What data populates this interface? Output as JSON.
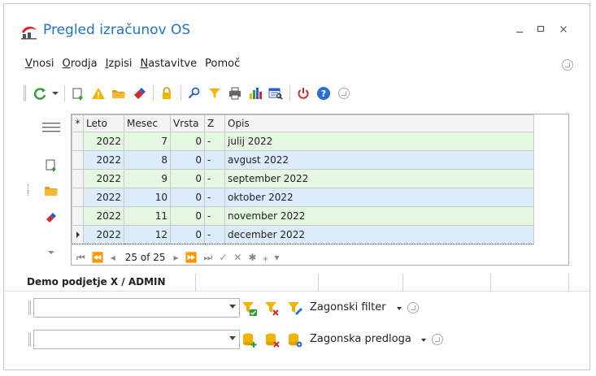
{
  "window": {
    "title": "Pregled izračunov OS"
  },
  "menu": {
    "items": [
      {
        "first": "V",
        "rest": "nosi"
      },
      {
        "first": "O",
        "rest": "rodja"
      },
      {
        "first": "I",
        "rest": "zpisi"
      },
      {
        "first": "N",
        "rest": "astavitve"
      },
      {
        "first": "",
        "rest": "Pomoč"
      }
    ]
  },
  "grid": {
    "columns": [
      "Leto",
      "Mesec",
      "Vrsta",
      "Z",
      "Opis"
    ],
    "rows": [
      {
        "leto": "2022",
        "mesec": "7",
        "vrsta": "0",
        "z": "-",
        "opis": "julij 2022"
      },
      {
        "leto": "2022",
        "mesec": "8",
        "vrsta": "0",
        "z": "-",
        "opis": "avgust 2022"
      },
      {
        "leto": "2022",
        "mesec": "9",
        "vrsta": "0",
        "z": "-",
        "opis": "september 2022"
      },
      {
        "leto": "2022",
        "mesec": "10",
        "vrsta": "0",
        "z": "-",
        "opis": "oktober 2022"
      },
      {
        "leto": "2022",
        "mesec": "11",
        "vrsta": "0",
        "z": "-",
        "opis": "november 2022"
      },
      {
        "leto": "2022",
        "mesec": "12",
        "vrsta": "0",
        "z": "-",
        "opis": "december 2022"
      }
    ],
    "navigator": {
      "counter": "25 of 25"
    }
  },
  "status": {
    "company_user": "Demo podjetje X / ADMIN"
  },
  "filter": {
    "value": "",
    "label": "Zagonski filter"
  },
  "template": {
    "value": "",
    "label": "Zagonska predloga"
  },
  "colors": {
    "title": "#1e73c6",
    "row_green": "#e4f7e0",
    "row_blue": "#dcecfb"
  }
}
